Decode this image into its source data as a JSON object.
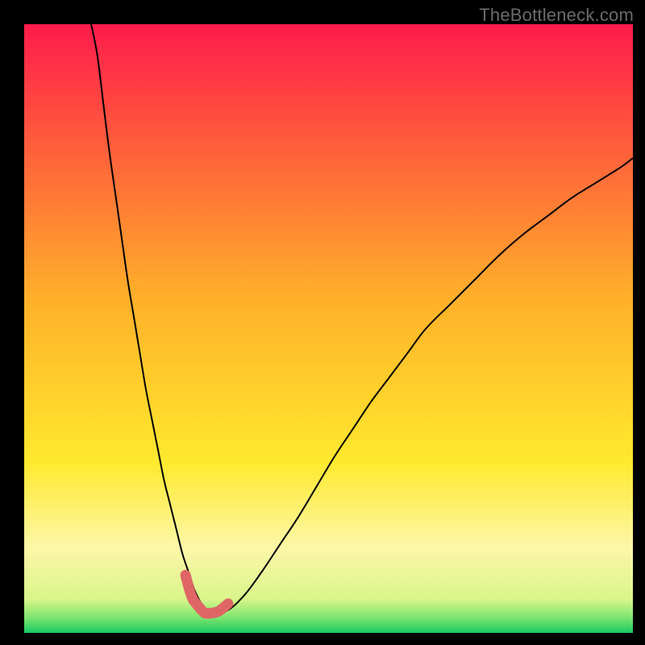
{
  "watermark": "TheBottleneck.com",
  "chart_data": {
    "type": "line",
    "title": "",
    "xlabel": "",
    "ylabel": "",
    "xlim": [
      0,
      100
    ],
    "ylim": [
      0,
      100
    ],
    "grid": false,
    "legend": false,
    "annotations": [],
    "background_gradient": {
      "stops": [
        {
          "offset": 0.0,
          "color": "#ff1b4b"
        },
        {
          "offset": 0.45,
          "color": "#ffb029"
        },
        {
          "offset": 0.72,
          "color": "#ffe92e"
        },
        {
          "offset": 0.86,
          "color": "#fdf7a8"
        },
        {
          "offset": 0.945,
          "color": "#d9f58a"
        },
        {
          "offset": 0.975,
          "color": "#7de56f"
        },
        {
          "offset": 1.0,
          "color": "#18c864"
        }
      ]
    },
    "series": [
      {
        "name": "black-curve",
        "color": "#000000",
        "stroke_width": 2,
        "x": [
          11,
          12,
          13,
          14,
          15,
          16,
          17,
          18,
          19,
          20,
          21,
          22,
          23,
          24,
          25,
          26,
          27,
          28,
          29,
          30,
          33,
          36,
          39,
          42,
          45,
          48,
          51,
          54,
          57,
          60,
          63,
          66,
          70,
          74,
          78,
          82,
          86,
          90,
          94,
          98,
          100
        ],
        "y": [
          100,
          95,
          87,
          79,
          72,
          65,
          58,
          52,
          46,
          40,
          35,
          30,
          25,
          21,
          17,
          13,
          10,
          7,
          5,
          3.5,
          3.5,
          6,
          10,
          14.5,
          19,
          24,
          29,
          33.5,
          38,
          42,
          46,
          50,
          54,
          58,
          62,
          65.5,
          68.5,
          71.5,
          74,
          76.5,
          78
        ]
      },
      {
        "name": "red-accent-curve",
        "color": "#e06666",
        "stroke_width": 13,
        "linecap": "round",
        "x": [
          26.5,
          27.5,
          28.5,
          29.5,
          30,
          31,
          32,
          33.5
        ],
        "y": [
          9.5,
          6,
          4.5,
          3.4,
          3.2,
          3.3,
          3.6,
          4.8
        ]
      }
    ]
  }
}
